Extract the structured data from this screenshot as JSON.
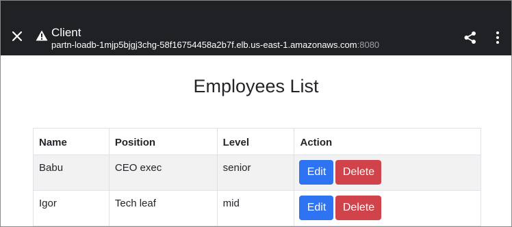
{
  "topbar": {
    "title": "Client",
    "url_host": "partn-loadb-1mjp5bjgj3chg-58f16754458a2b7f.elb.us-east-1.amazonaws.com",
    "url_port": ":8080",
    "icons": [
      "close-icon",
      "warning-icon",
      "share-icon",
      "more-vert-icon"
    ]
  },
  "page": {
    "heading": "Employees List"
  },
  "table": {
    "headers": [
      "Name",
      "Position",
      "Level",
      "Action"
    ],
    "rows": [
      {
        "name": "Babu",
        "position": "CEO exec",
        "level": "senior",
        "edit": "Edit",
        "delete": "Delete"
      },
      {
        "name": "Igor",
        "position": "Tech leaf",
        "level": "mid",
        "edit": "Edit",
        "delete": "Delete"
      }
    ]
  },
  "colors": {
    "topbar_bg": "#202124",
    "edit_button": "#2e74f2",
    "delete_button": "#d0434a"
  }
}
